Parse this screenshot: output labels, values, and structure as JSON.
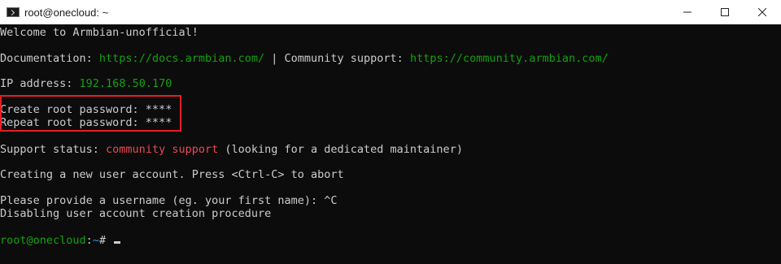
{
  "window": {
    "title": "root@onecloud: ~"
  },
  "terminal": {
    "welcome": "Welcome to Armbian-unofficial!",
    "documentation_label": "Documentation: ",
    "documentation_url": "https://docs.armbian.com/",
    "separator": " | Community support: ",
    "community_url": "https://community.armbian.com/",
    "ip_label": "IP address: ",
    "ip_value": "192.168.50.170",
    "create_password": "Create root password: ****",
    "repeat_password": "Repeat root password: ****",
    "support_label": "Support status: ",
    "support_value": "community support",
    "support_note": " (looking for a dedicated maintainer)",
    "creating_user": "Creating a new user account. Press <Ctrl-C> to abort",
    "provide_username": "Please provide a username (eg. your first name): ^C",
    "disabling": "Disabling user account creation procedure",
    "prompt_user": "root@onecloud",
    "prompt_sep": ":",
    "prompt_path": "~",
    "prompt_symbol": "# "
  },
  "colors": {
    "background": "#0c0c0c",
    "text": "#cccccc",
    "green": "#13a10e",
    "red": "#e74856",
    "highlight_box": "#e81c24"
  }
}
